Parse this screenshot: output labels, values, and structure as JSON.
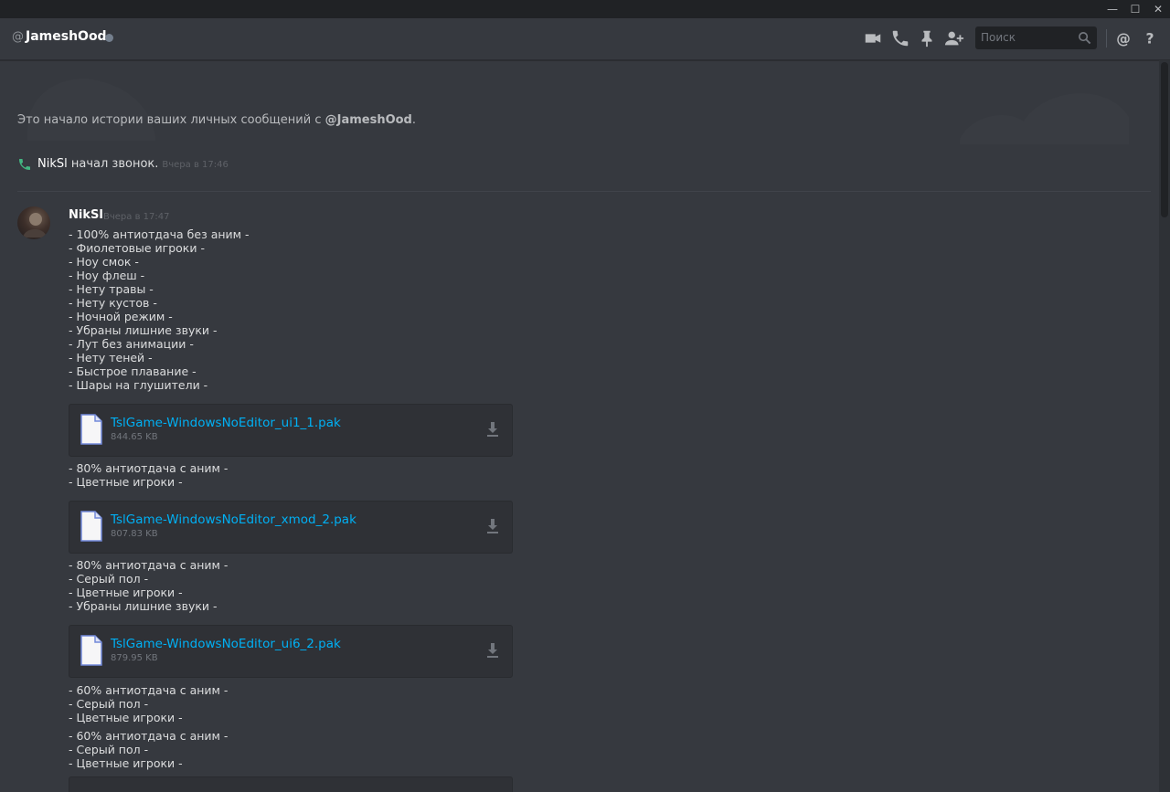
{
  "window": {
    "minimize": "—",
    "maximize": "☐",
    "close": "✕"
  },
  "header": {
    "at": "@",
    "username": "JameshOod",
    "search_placeholder": "Поиск",
    "icons": [
      "video-call-icon",
      "voice-call-icon",
      "pin-icon",
      "add-friend-icon",
      "search-icon",
      "mention-icon",
      "help-icon"
    ]
  },
  "intro": {
    "text": "Это начало истории ваших личных сообщений с ",
    "user": "@JameshOod",
    "end": "."
  },
  "call": {
    "user": "NikSl",
    "text": " начал звонок.",
    "time": "Вчера в 17:46"
  },
  "message": {
    "author": "NikSl",
    "time": "Вчера в 17:47",
    "group1": [
      "- 100% антиотдача без аним -",
      "- Фиолетовые игроки -",
      "- Ноу смок -",
      "- Ноу флеш -",
      "- Нету травы -",
      "- Нету кустов -",
      "- Ночной режим -",
      "- Убраны лишние звуки -",
      "- Лут без анимации -",
      "- Нету теней -",
      "- Быстрое плавание -",
      "- Шары на глушители -"
    ],
    "attachment1": {
      "name": "TslGame-WindowsNoEditor_ui1_1.pak",
      "size": "844.65 KB"
    },
    "group2": [
      "- 80% антиотдача с аним -",
      "- Цветные игроки -"
    ],
    "attachment2": {
      "name": "TslGame-WindowsNoEditor_xmod_2.pak",
      "size": "807.83 KB"
    },
    "group3": [
      "- 80% антиотдача с аним -",
      "- Серый пол -",
      "- Цветные игроки -",
      "- Убраны лишние звуки -"
    ],
    "attachment3": {
      "name": "TslGame-WindowsNoEditor_ui6_2.pak",
      "size": "879.95 KB"
    },
    "group4": [
      "- 60% антиотдача с аним -",
      "- Серый пол -",
      "- Цветные игроки -"
    ],
    "group5": [
      "- 60% антиотдача с аним -",
      "- Серый пол -",
      "- Цветные игроки -"
    ]
  },
  "colors": {
    "background": "#36393f",
    "link": "#00b0f4",
    "call_green": "#43b581",
    "attachment_bg": "#2f3136"
  }
}
